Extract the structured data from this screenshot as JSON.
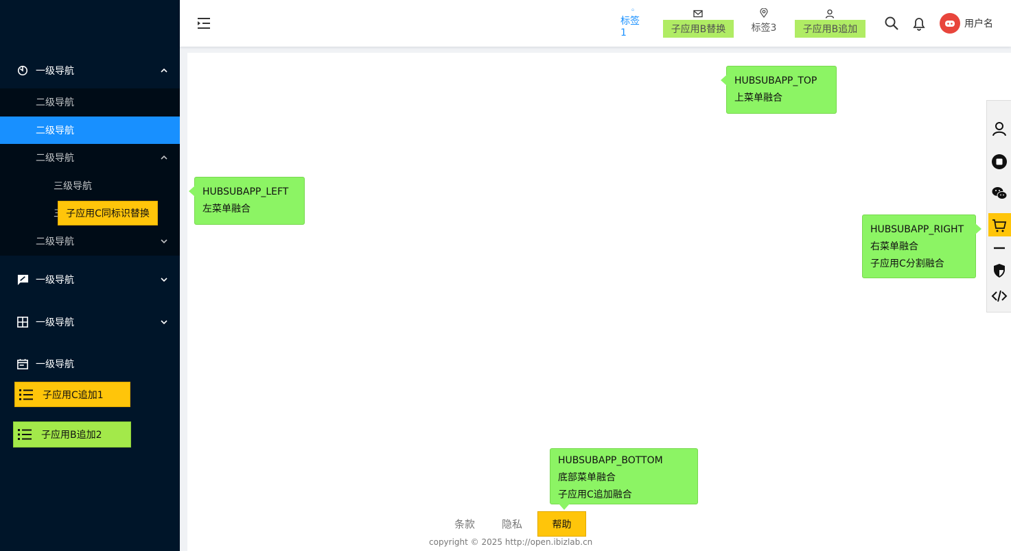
{
  "sidebar": {
    "items": [
      {
        "label": "一级导航",
        "icon": "timer-icon",
        "expanded": true
      },
      {
        "label": "一级导航",
        "icon": "feedback-icon",
        "expanded": false
      },
      {
        "label": "一级导航",
        "icon": "grid-icon",
        "expanded": false
      },
      {
        "label": "一级导航",
        "icon": "calendar-icon",
        "expanded": false
      }
    ],
    "sub_items": [
      {
        "label": "二级导航"
      },
      {
        "label": "二级导航",
        "active": true
      },
      {
        "label": "二级导航",
        "expanded": true
      },
      {
        "label": "二级导航",
        "expanded": false
      }
    ],
    "third_items": [
      {
        "label": "三级导航"
      },
      {
        "label": "三"
      }
    ],
    "replace_sticker": "子应用C同标识替换",
    "append_c": "子应用C追加1",
    "append_b": "子应用B追加2"
  },
  "header": {
    "tabs": [
      {
        "label": "标签1",
        "icon": "home-icon",
        "active": true
      },
      {
        "label": "子应用B替换",
        "icon": "mail-icon"
      },
      {
        "label": "标签3",
        "icon": "location-icon"
      },
      {
        "label": "子应用B追加",
        "icon": "user-icon"
      }
    ],
    "username": "用户名"
  },
  "tips": {
    "top": [
      "HUBSUBAPP_TOP",
      "上菜单融合"
    ],
    "left": [
      "HUBSUBAPP_LEFT",
      "左菜单融合"
    ],
    "right": [
      "HUBSUBAPP_RIGHT",
      "右菜单融合",
      "子应用C分割融合"
    ],
    "bottom": [
      "HUBSUBAPP_BOTTOM",
      "底部菜单融合",
      "子应用C追加融合"
    ]
  },
  "right_toolbar": [
    "user-icon",
    "stop-icon",
    "wechat-icon",
    "cart-icon",
    "minus-icon",
    "shield-icon",
    "code-icon"
  ],
  "footer": {
    "terms": "条款",
    "privacy": "隐私",
    "help": "帮助",
    "copyright": "copyright © 2025    http://open.ibizlab.cn"
  },
  "colors": {
    "sidebar": "#001529",
    "active": "#1890ff",
    "tip": "#8cf464",
    "yellow": "#ffc50a",
    "lime": "#a3e94a"
  }
}
